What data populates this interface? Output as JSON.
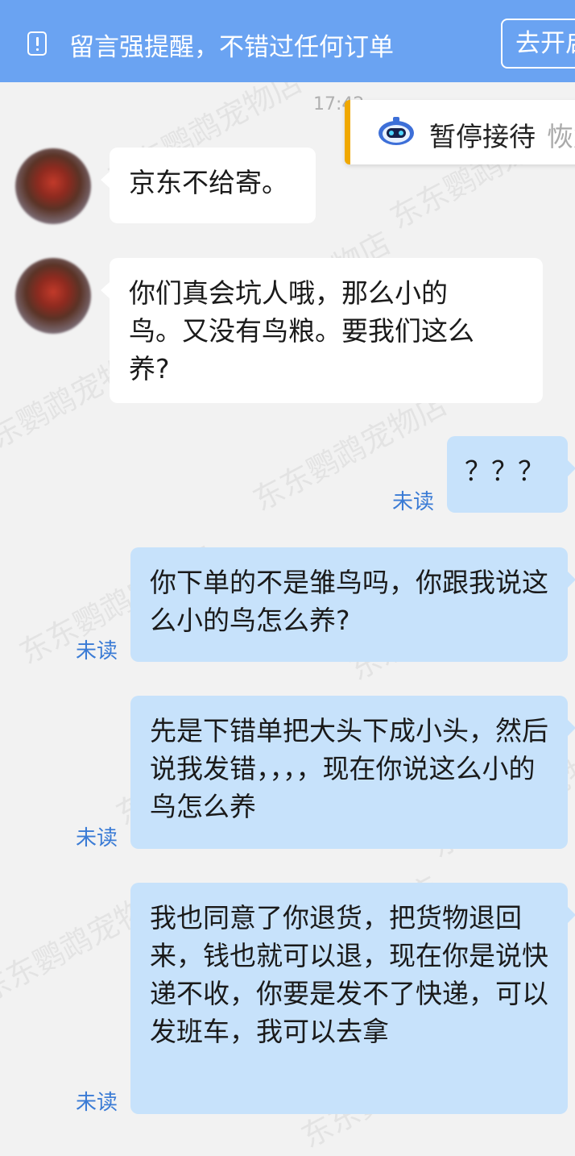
{
  "banner": {
    "text": "留言强提醒，不错过任何订单",
    "button_label": "去开启"
  },
  "timestamp": "17:42",
  "status_card": {
    "label": "暂停接待",
    "extra": "恢复"
  },
  "watermark": "东东鹦鹉宠物店",
  "messages": [
    {
      "side": "left",
      "text": "京东不给寄。"
    },
    {
      "side": "left",
      "text": "你们真会坑人哦，那么小的鸟。又没有鸟粮。要我们这么养?"
    },
    {
      "side": "right",
      "text": "？？？",
      "status": "未读"
    },
    {
      "side": "right",
      "text": "你下单的不是雏鸟吗，你跟我说这么小的鸟怎么养?",
      "status": "未读"
    },
    {
      "side": "right",
      "text": "先是下错单把大头下成小头，然后说我发错，，，，现在你说这么小的鸟怎么养",
      "status": "未读"
    },
    {
      "side": "right",
      "text": "我也同意了你退货，把货物退回来，钱也就可以退，现在你是说快递不收，你要是发不了快递，可以发班车，我可以去拿",
      "status": "未读"
    }
  ]
}
